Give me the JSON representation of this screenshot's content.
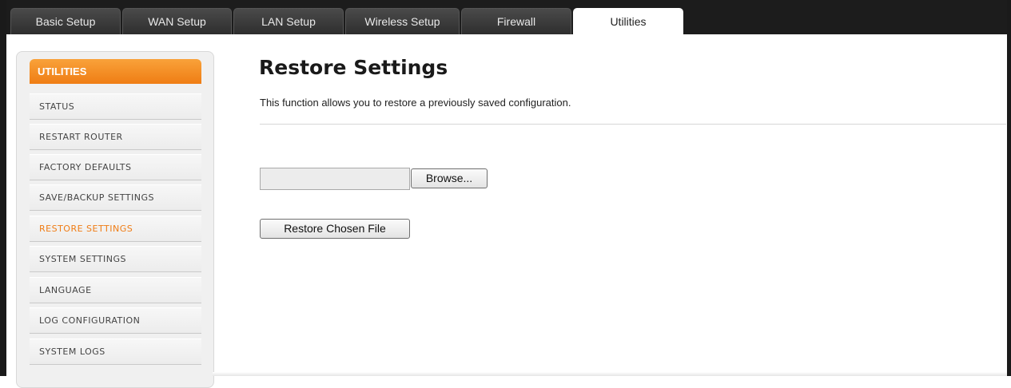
{
  "nav": {
    "tabs": [
      {
        "label": "Basic Setup"
      },
      {
        "label": "WAN Setup"
      },
      {
        "label": "LAN Setup"
      },
      {
        "label": "Wireless Setup"
      },
      {
        "label": "Firewall"
      },
      {
        "label": "Utilities",
        "active": true
      }
    ]
  },
  "sidebar": {
    "header": "UTILITIES",
    "items": [
      {
        "label": "STATUS"
      },
      {
        "label": "RESTART ROUTER"
      },
      {
        "label": "FACTORY DEFAULTS"
      },
      {
        "label": "SAVE/BACKUP SETTINGS"
      },
      {
        "label": "RESTORE SETTINGS",
        "active": true
      },
      {
        "label": "SYSTEM SETTINGS"
      },
      {
        "label": "LANGUAGE"
      },
      {
        "label": "LOG CONFIGURATION"
      },
      {
        "label": "SYSTEM LOGS"
      }
    ]
  },
  "main": {
    "title": "Restore Settings",
    "description": "This function allows you to restore a previously saved configuration.",
    "file_value": "",
    "browse_label": "Browse...",
    "restore_label": "Restore Chosen File"
  },
  "colors": {
    "accent": "#f07c14",
    "nav_background": "#1c1c1c"
  }
}
